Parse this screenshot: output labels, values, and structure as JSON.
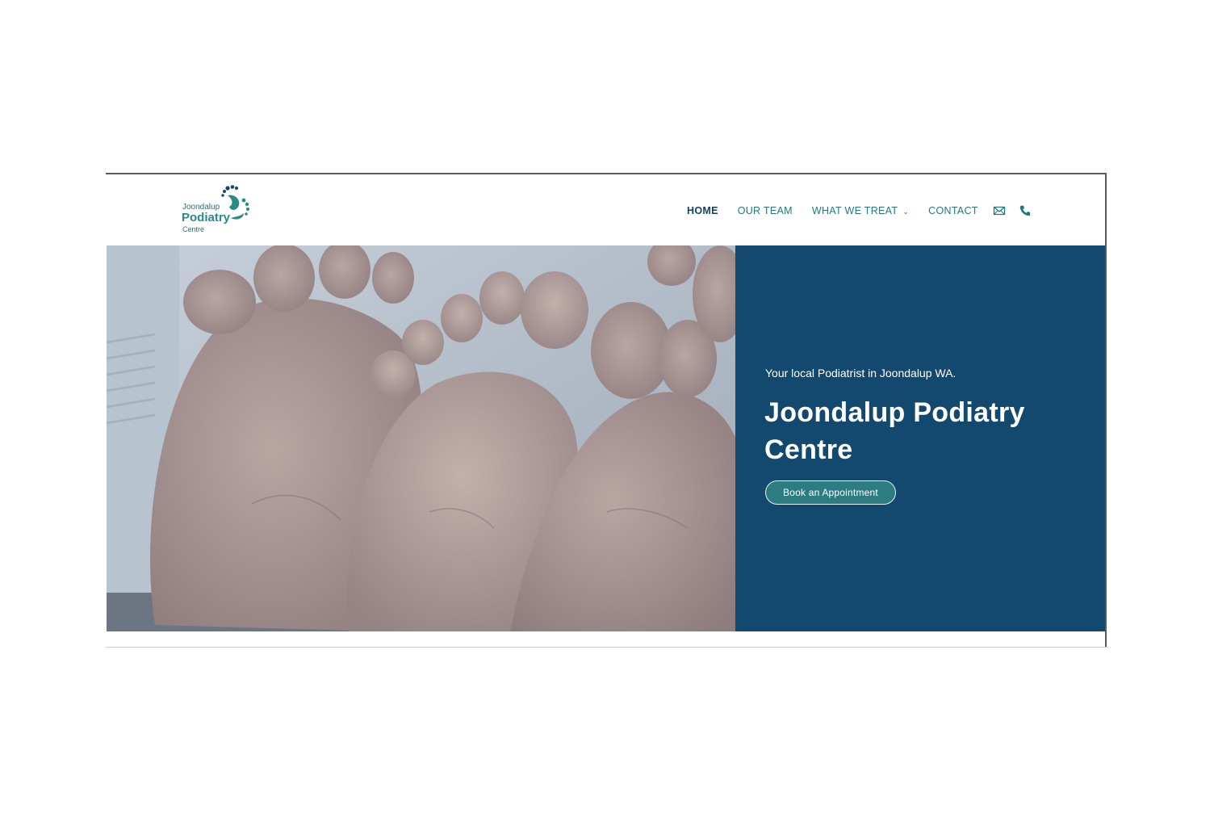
{
  "logo": {
    "line1": "Joondalup",
    "line2": "Podiatry",
    "line3": "Centre"
  },
  "nav": {
    "items": [
      {
        "label": "HOME",
        "active": true
      },
      {
        "label": "OUR TEAM",
        "active": false
      },
      {
        "label": "WHAT WE TREAT",
        "active": false,
        "has_dropdown": true
      },
      {
        "label": "CONTACT",
        "active": false
      }
    ],
    "icons": [
      "mail-icon",
      "phone-icon"
    ]
  },
  "hero": {
    "tagline": "Your local Podiatrist in Joondalup WA.",
    "title": "Joondalup Podiatry Centre",
    "cta_label": "Book an Appointment",
    "image_subject": "feet-soles-photo"
  },
  "colors": {
    "panel": "#14496f",
    "accent": "#1f7a7e",
    "button": "#2d7c82",
    "nav_active": "#143f5e"
  }
}
